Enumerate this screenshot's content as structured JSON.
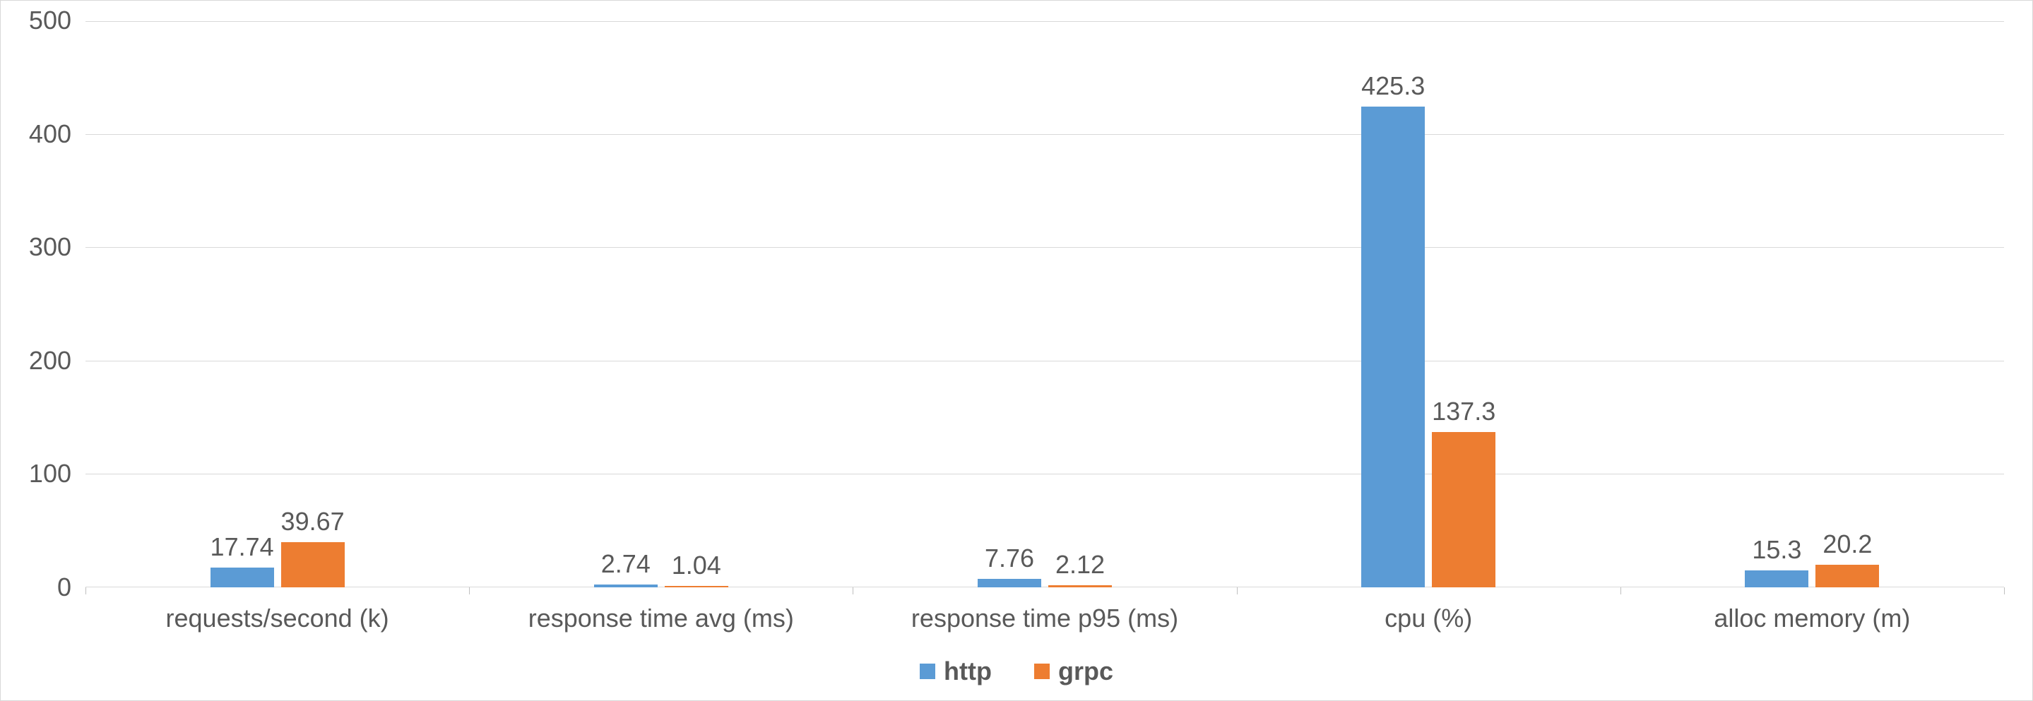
{
  "chart_data": {
    "type": "bar",
    "categories": [
      "requests/second (k)",
      "response time avg (ms)",
      "response time p95 (ms)",
      "cpu (%)",
      "alloc memory (m)"
    ],
    "series": [
      {
        "name": "http",
        "values": [
          17.74,
          2.74,
          7.76,
          425.3,
          15.3
        ],
        "color": "#5b9bd5"
      },
      {
        "name": "grpc",
        "values": [
          39.67,
          1.04,
          2.12,
          137.3,
          20.2
        ],
        "color": "#ed7d31"
      }
    ],
    "ylim": [
      0,
      500
    ],
    "yticks": [
      0,
      100,
      200,
      300,
      400,
      500
    ],
    "title": "",
    "xlabel": "",
    "ylabel": ""
  },
  "legend": {
    "http": "http",
    "grpc": "grpc"
  }
}
